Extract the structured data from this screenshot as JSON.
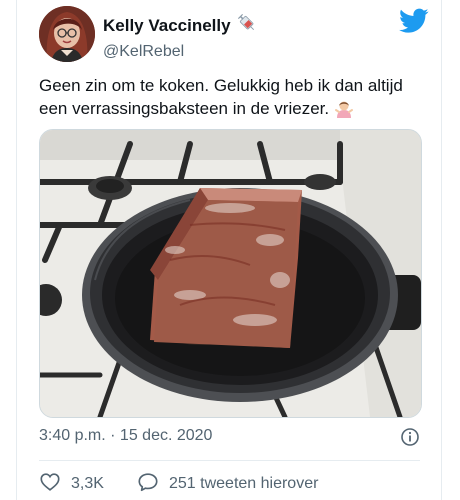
{
  "tweet": {
    "author": {
      "display_name": "Kelly Vaccinelly",
      "name_emoji": "syringe-emoji",
      "handle": "@KelRebel"
    },
    "text": "Geen zin om te koken. Gelukkig heb ik dan altijd een verrassingsbaksteen in de vriezer.",
    "text_emoji": "woman-shrugging-emoji",
    "media": {
      "description_icon": "frozen-block-in-frying-pan-photo"
    },
    "timestamp": "3:40 p.m. · 15 dec. 2020",
    "likes": "3,3K",
    "replies_label": "251 tweeten hierover"
  },
  "colors": {
    "brand": "#1d9bf0",
    "text": "#0f1419",
    "secondary": "#536471",
    "border": "#e6ecf0"
  },
  "icons": {
    "logo": "twitter-bird-icon",
    "info": "info-icon",
    "like": "heart-icon",
    "reply": "speech-bubble-icon"
  }
}
